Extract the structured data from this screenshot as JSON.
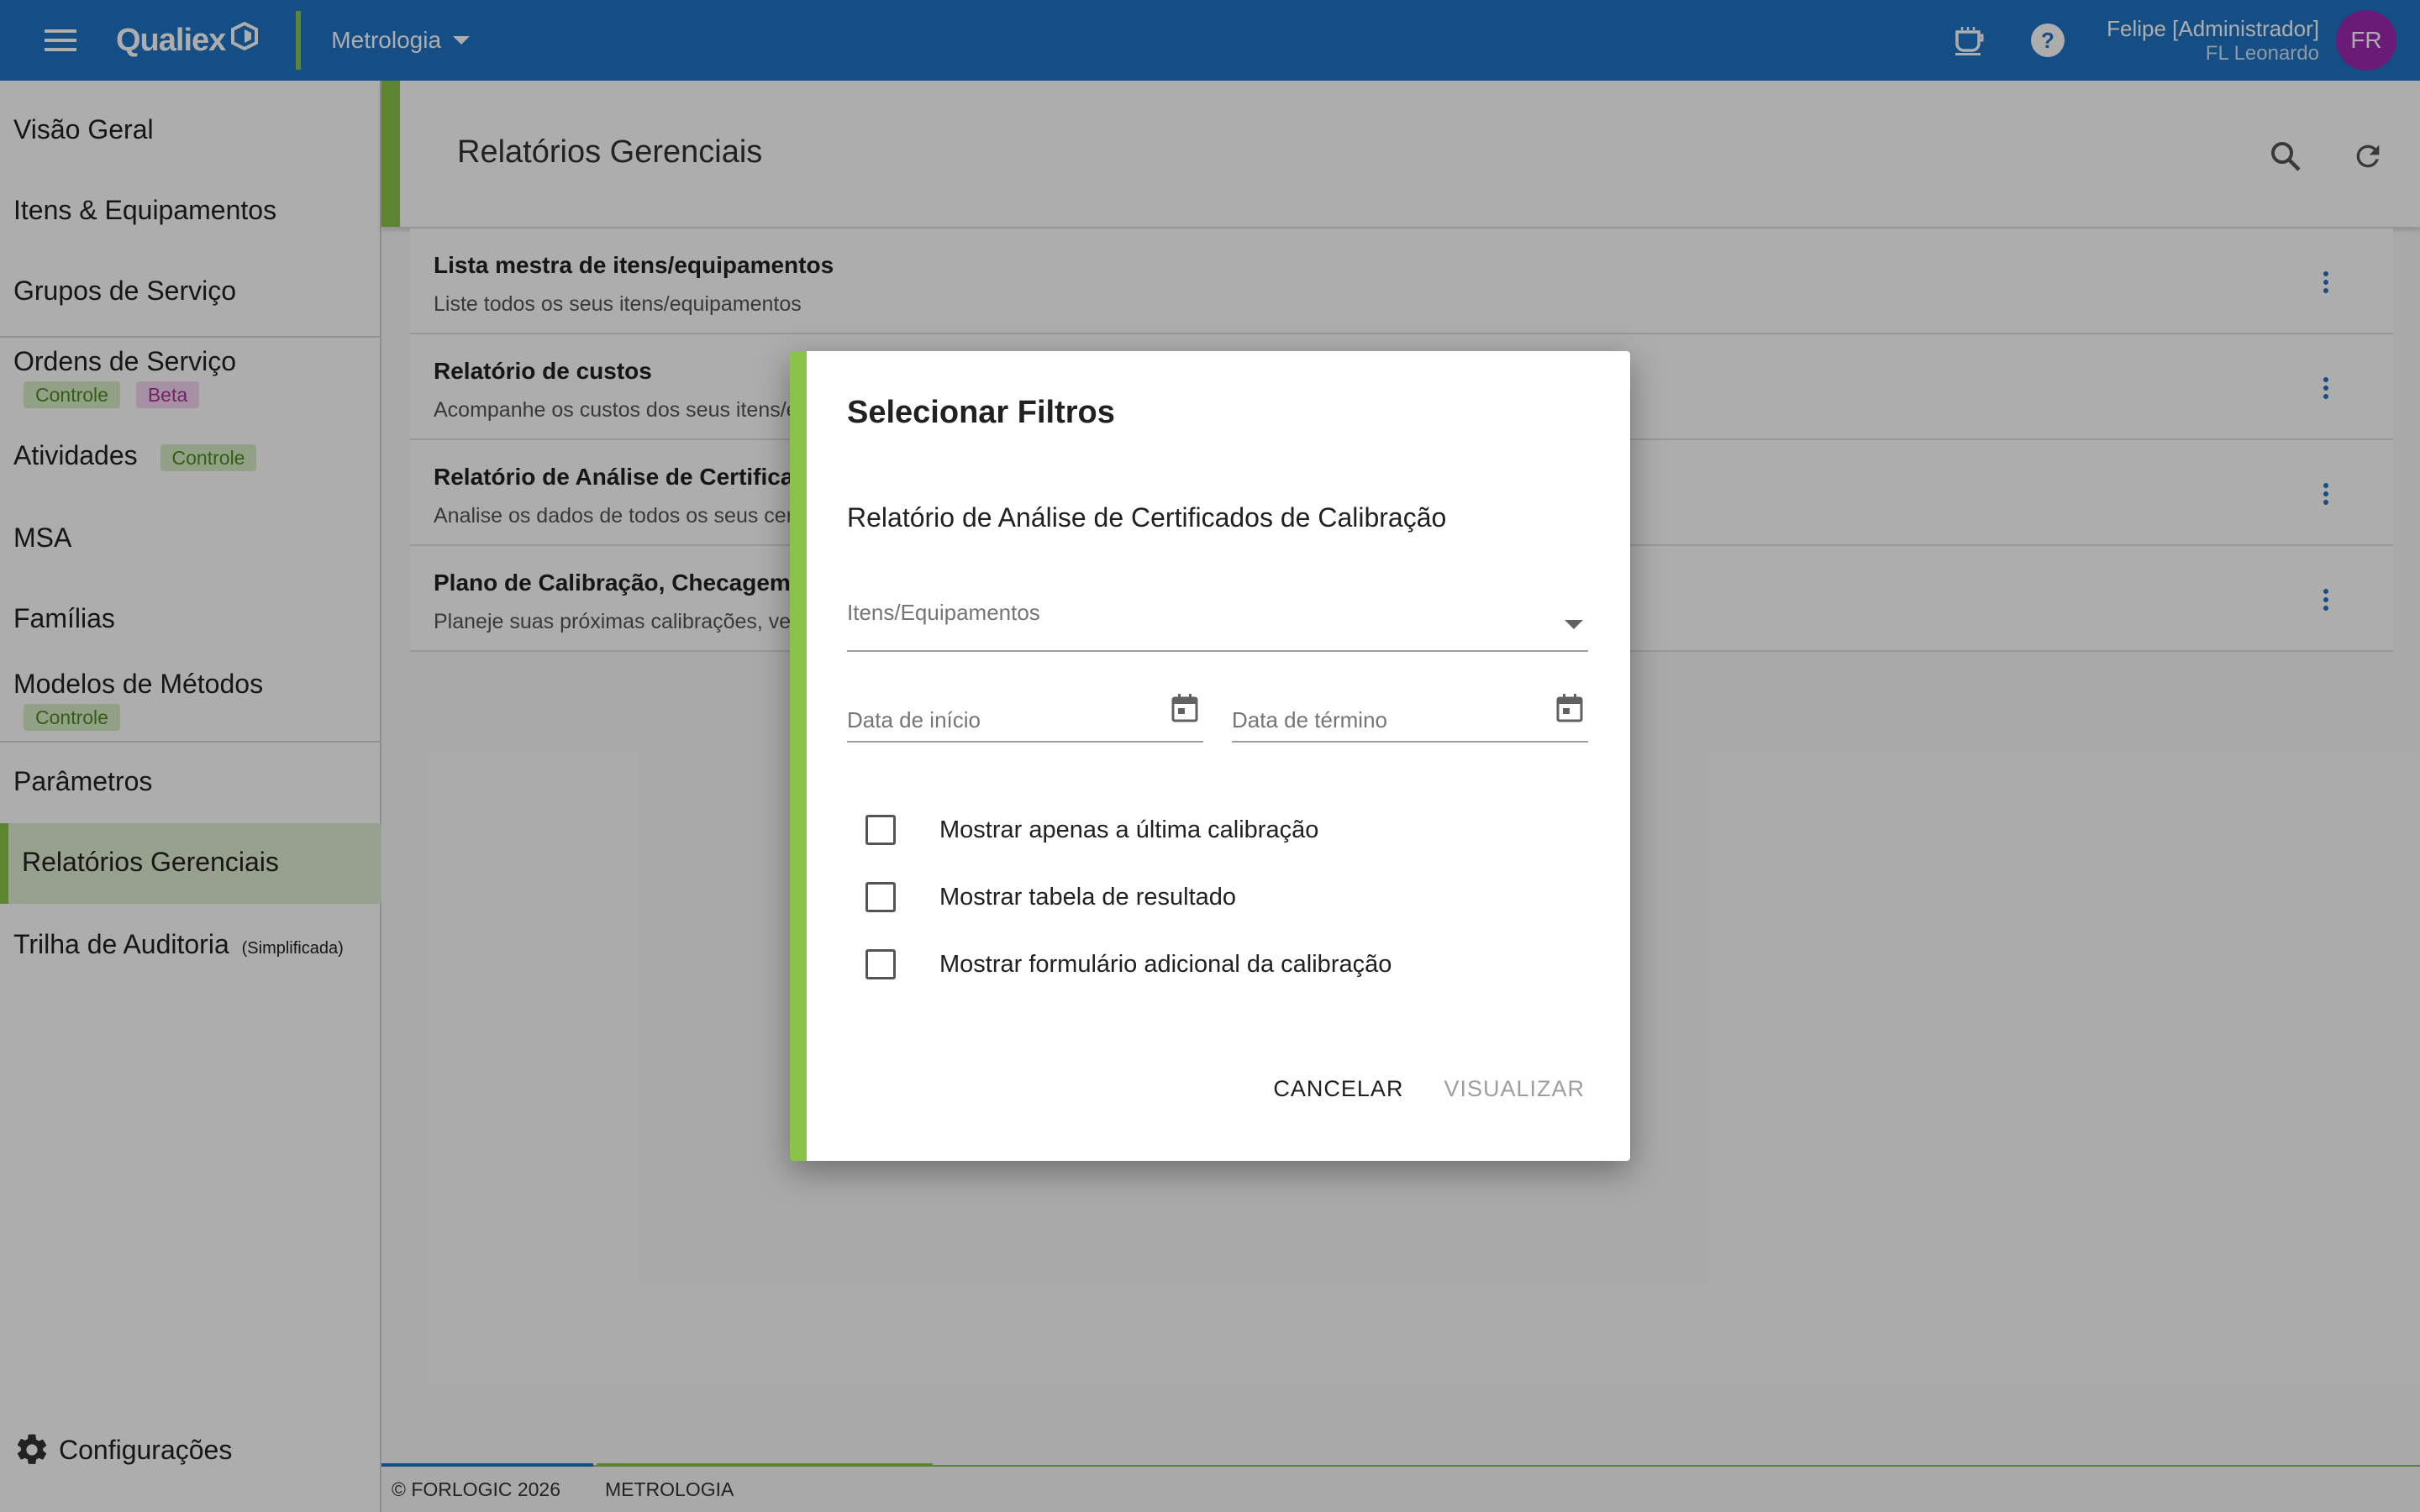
{
  "topbar": {
    "brand": "Qualiex",
    "module": "Metrologia",
    "user_name": "Felipe [Administrador]",
    "user_org": "FL Leonardo",
    "avatar_initials": "FR",
    "colors": {
      "bar": "#1e74c4",
      "accent": "#8bc34a",
      "avatar": "#9c27b0"
    }
  },
  "sidebar": {
    "items": [
      {
        "label": "Visão Geral"
      },
      {
        "label": "Itens & Equipamentos"
      },
      {
        "label": "Grupos de Serviço"
      },
      {
        "label": "Ordens de Serviço",
        "badges": [
          "Controle",
          "Beta"
        ]
      },
      {
        "label": "Atividades",
        "badges": [
          "Controle"
        ]
      },
      {
        "label": "MSA"
      },
      {
        "label": "Famílias"
      },
      {
        "label": "Modelos de Métodos",
        "badges": [
          "Controle"
        ]
      },
      {
        "label": "Parâmetros"
      },
      {
        "label": "Relatórios Gerenciais",
        "active": true
      },
      {
        "label": "Trilha de Auditoria",
        "suffix": "(Simplificada)"
      }
    ],
    "settings_label": "Configurações"
  },
  "main": {
    "title": "Relatórios Gerenciais",
    "reports": [
      {
        "title": "Lista mestra de itens/equipamentos",
        "desc": "Liste todos os seus itens/equipamentos"
      },
      {
        "title": "Relatório de custos",
        "desc": "Acompanhe os custos dos seus itens/e"
      },
      {
        "title": "Relatório de Análise de Certificado",
        "desc": "Analise os dados de todos os seus cert"
      },
      {
        "title": "Plano de Calibração, Checagem e",
        "desc": "Planeje suas próximas calibrações, veri"
      }
    ]
  },
  "footer": {
    "copyright": "© FORLOGIC 2026",
    "module": "METROLOGIA"
  },
  "dialog": {
    "title": "Selecionar Filtros",
    "subtitle": "Relatório de Análise de Certificados de Calibração",
    "items_placeholder": "Itens/Equipamentos",
    "start_date_placeholder": "Data de início",
    "end_date_placeholder": "Data de término",
    "checkboxes": [
      {
        "label": "Mostrar apenas a última calibração",
        "checked": false
      },
      {
        "label": "Mostrar tabela de resultado",
        "checked": false
      },
      {
        "label": "Mostrar formulário adicional da calibração",
        "checked": false
      }
    ],
    "cancel_label": "CANCELAR",
    "view_label": "VISUALIZAR"
  }
}
